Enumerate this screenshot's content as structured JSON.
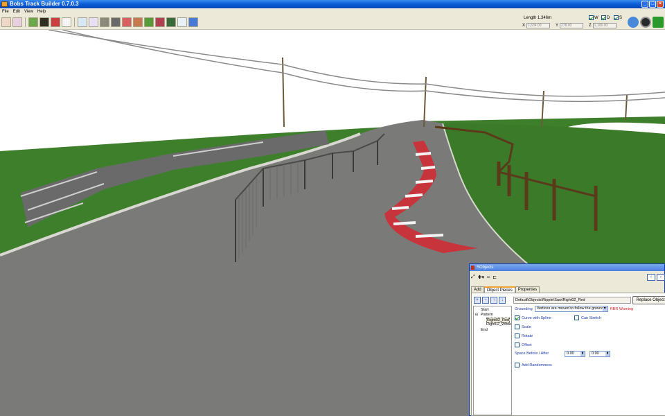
{
  "window": {
    "title": "Bobs Track Builder 0.7.0.3"
  },
  "menu": [
    "File",
    "Edit",
    "View",
    "Help"
  ],
  "status": {
    "length_label": "Length 1.346m",
    "checks": [
      {
        "label": "W",
        "checked": true
      },
      {
        "label": "D",
        "checked": true
      },
      {
        "label": "S",
        "checked": true
      }
    ],
    "x_label": "X",
    "x_value": "1,634.00",
    "y_label": "Y",
    "y_value": "278.00",
    "z_label": "Z",
    "z_value": "1,106.00"
  },
  "panel": {
    "title": "SObjects",
    "tabs": [
      "Add",
      "Object Pieces",
      "Properties"
    ],
    "active_tab": "Object Pieces",
    "path": "Default\\Objects\\Ripple\\Saw\\Right02_Red",
    "replace_button": "Replace Object",
    "tree": {
      "start": "Start",
      "pattern": "Pattern",
      "child_1": "Right02_Red",
      "child_2": "Right02_White",
      "end": "End"
    },
    "grounding_label": "Grounding",
    "grounding_value": "Vertices are moved to follow the ground",
    "warning": "RBR Warning",
    "curve_label": "Curve with Spline",
    "stretch_label": "Can Stretch",
    "scale_label": "Scale",
    "rotate_label": "Rotate",
    "offset_label": "Offset",
    "space_label": "Space Before / After",
    "space_before": "0.00",
    "space_after": "0.00",
    "random_label": "Add Randomness"
  }
}
